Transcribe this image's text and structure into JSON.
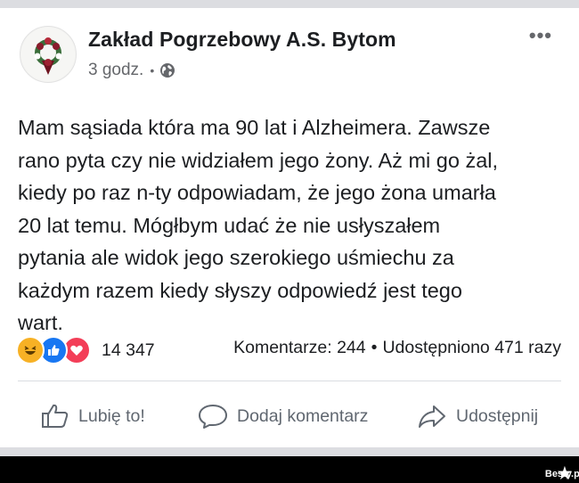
{
  "post": {
    "author": "Zakład Pogrzebowy A.S. Bytom",
    "time": "3 godz.",
    "visibility_icon": "globe-icon",
    "more_icon": "more-options-icon",
    "text": "Mam sąsiada która ma 90 lat i Alzheimera. Zawsze\nrano pyta czy nie widziałem jego żony. Aż mi go żal,\nkiedy po raz n-ty odpowiadam, że jego żona umarła\n20 lat temu. Mógłbym udać że nie usłyszałem\npytania ale widok jego szerokiego uśmiechu za\nkażdym razem kiedy słyszy odpowiedź jest tego\nwart."
  },
  "reactions": {
    "icons": [
      "haha-icon",
      "like-icon",
      "love-icon"
    ],
    "count": "14 347",
    "comments": "Komentarze: 244",
    "shares": "Udostępniono 471 razy"
  },
  "actions": {
    "like": "Lubię to!",
    "comment": "Dodaj komentarz",
    "share": "Udostępnij"
  },
  "watermark": "Besty.pl",
  "colors": {
    "like_blue": "#1877f2",
    "love_red": "#f33e58",
    "haha_yellow": "#f7b125",
    "secondary_text": "#65676b"
  }
}
